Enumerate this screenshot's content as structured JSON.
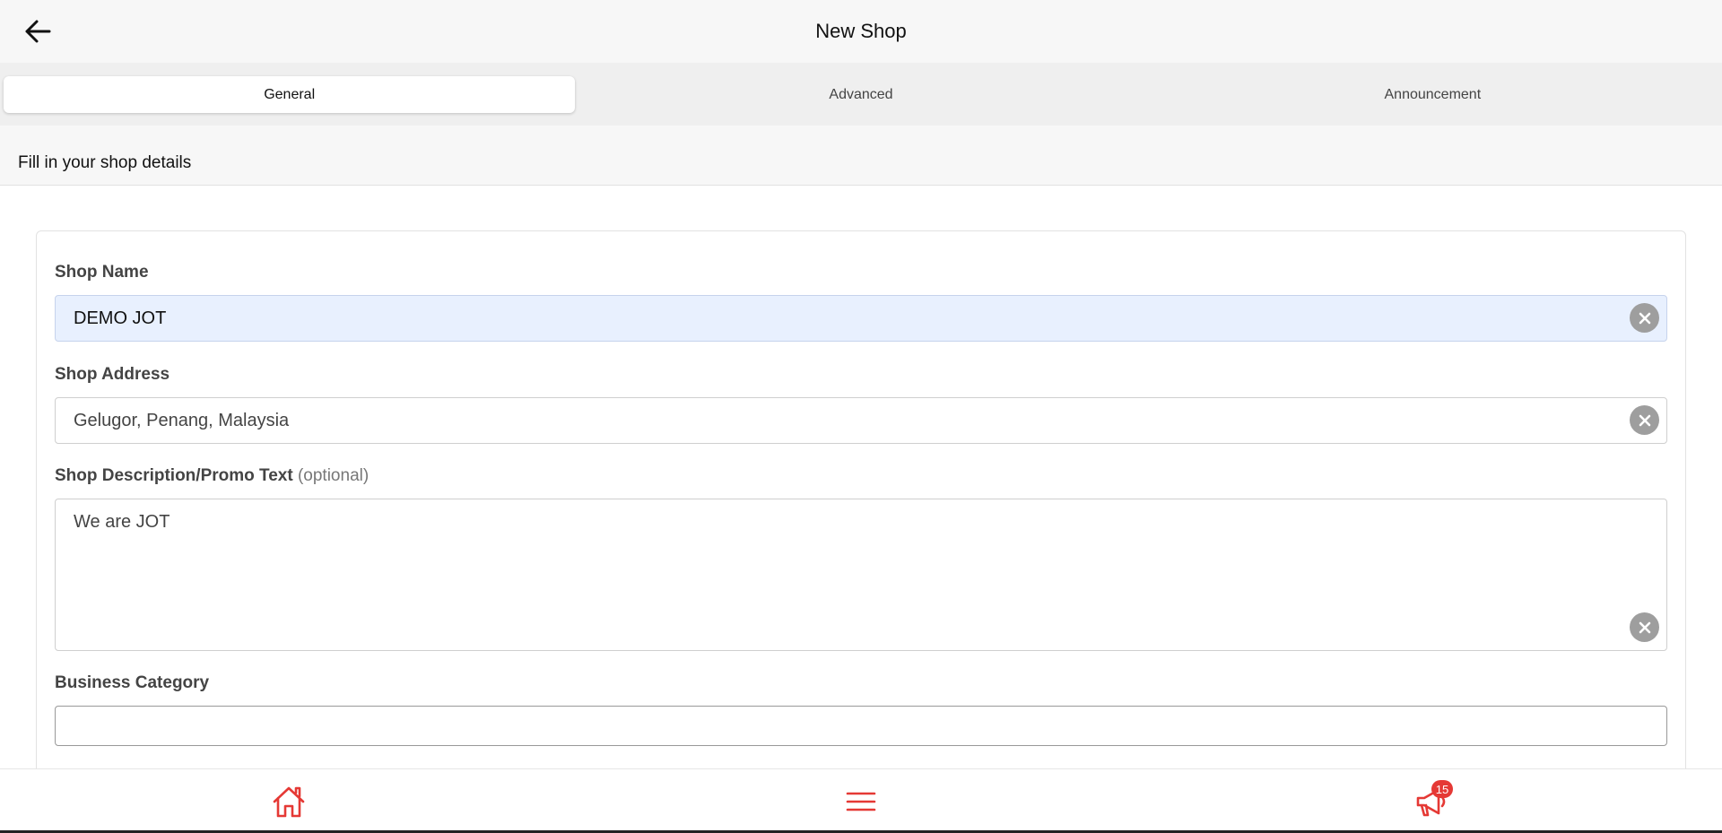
{
  "header": {
    "title": "New Shop",
    "back_icon": "arrow-left-icon"
  },
  "tabs": [
    {
      "label": "General",
      "active": true
    },
    {
      "label": "Advanced",
      "active": false
    },
    {
      "label": "Announcement",
      "active": false
    }
  ],
  "subheader": "Fill in your shop details",
  "form": {
    "shop_name": {
      "label": "Shop Name",
      "value": "DEMO JOT"
    },
    "shop_address": {
      "label": "Shop Address",
      "value": "Gelugor, Penang, Malaysia"
    },
    "shop_description": {
      "label": "Shop Description/Promo Text",
      "optional": "(optional)",
      "value": "We are JOT"
    },
    "business_category": {
      "label": "Business Category",
      "value": ""
    }
  },
  "bottom_nav": {
    "home_icon": "home-icon",
    "menu_icon": "menu-icon",
    "announcement_icon": "megaphone-icon",
    "announcement_badge": "15",
    "accent_color": "#e53935"
  }
}
